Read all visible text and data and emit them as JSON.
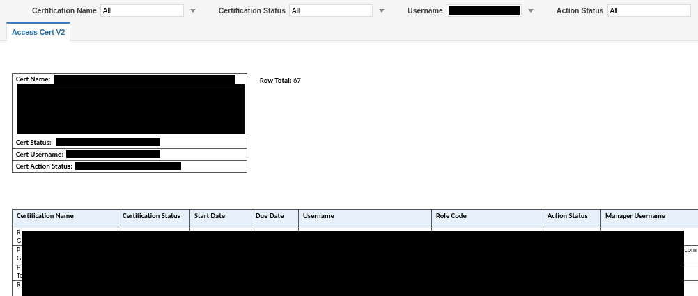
{
  "filters": [
    {
      "label": "Certification Name",
      "value": "All",
      "redacted": false
    },
    {
      "label": "Certification Status",
      "value": "All",
      "redacted": false
    },
    {
      "label": "Username",
      "redacted": true
    },
    {
      "label": "Action Status",
      "value": "All",
      "redacted": false
    }
  ],
  "tabs": [
    {
      "label": "Access Cert V2",
      "selected": true
    }
  ],
  "summary": {
    "rows": [
      "Cert Name:",
      "Cert Status:",
      "Cert Username:",
      "Cert Action Status:"
    ],
    "row_total_label": "Row Total:",
    "row_total": "67"
  },
  "table": {
    "columns": [
      "Certification Name",
      "Certification Status",
      "Start Date",
      "Due Date",
      "Username",
      "Role Code",
      "Action Status",
      "Manager Username"
    ],
    "rows": [
      {
        "first": [
          "R",
          "G"
        ],
        "last": ""
      },
      {
        "first": [
          "P",
          "G"
        ],
        "last": "com"
      },
      {
        "first": [
          "P",
          "Te"
        ],
        "last": ""
      },
      {
        "first": [
          "R"
        ],
        "last": ""
      }
    ]
  }
}
